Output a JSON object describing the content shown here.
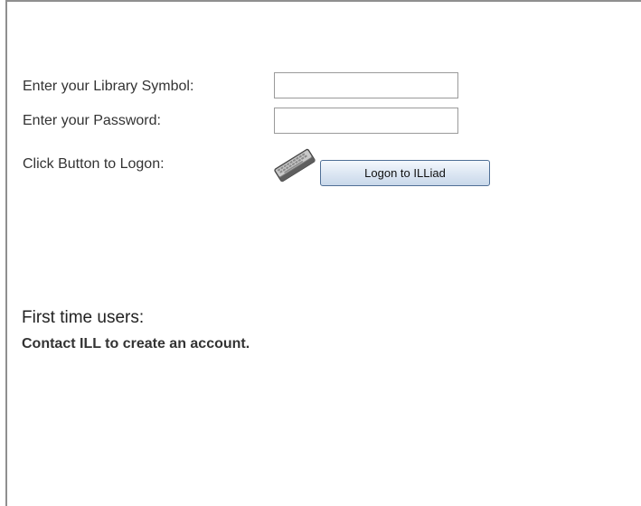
{
  "login": {
    "symbol_label": "Enter your Library Symbol:",
    "symbol_value": "",
    "password_label": "Enter your Password:",
    "password_value": "",
    "logon_label": "Click Button to Logon:",
    "logon_button": "Logon to ILLiad",
    "icon": "keyboard-icon"
  },
  "info": {
    "first_time": "First time users:",
    "contact": "Contact ILL to create an account."
  },
  "colors": {
    "border": "#8f8f8f",
    "button_border": "#4f6f96",
    "button_fill": "#dde7f3",
    "text": "#333333"
  }
}
